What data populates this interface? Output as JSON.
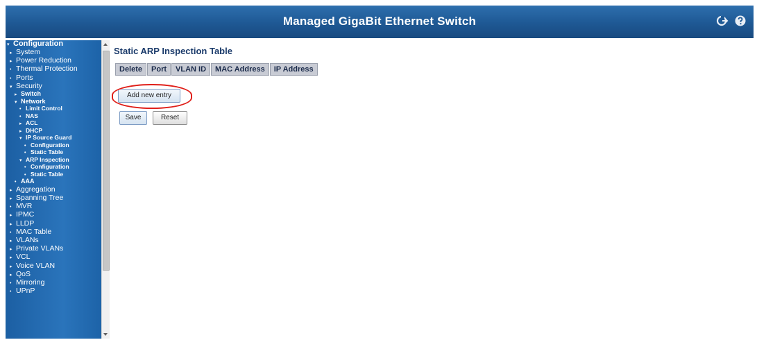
{
  "header": {
    "title": "Managed GigaBit Ethernet Switch"
  },
  "sidebar": {
    "items": [
      {
        "label": "Configuration",
        "marker": "▾",
        "level": 0
      },
      {
        "label": "System",
        "marker": "▸",
        "level": 1
      },
      {
        "label": "Power Reduction",
        "marker": "▸",
        "level": 1
      },
      {
        "label": "Thermal Protection",
        "marker": "•",
        "level": 1
      },
      {
        "label": "Ports",
        "marker": "•",
        "level": 1
      },
      {
        "label": "Security",
        "marker": "▾",
        "level": 1
      },
      {
        "label": "Switch",
        "marker": "▸",
        "level": 2
      },
      {
        "label": "Network",
        "marker": "▾",
        "level": 2
      },
      {
        "label": "Limit Control",
        "marker": "•",
        "level": 3
      },
      {
        "label": "NAS",
        "marker": "•",
        "level": 3
      },
      {
        "label": "ACL",
        "marker": "▸",
        "level": 3
      },
      {
        "label": "DHCP",
        "marker": "▸",
        "level": 3
      },
      {
        "label": "IP Source Guard",
        "marker": "▾",
        "level": 3
      },
      {
        "label": "Configuration",
        "marker": "•",
        "level": 4
      },
      {
        "label": "Static Table",
        "marker": "•",
        "level": 4
      },
      {
        "label": "ARP Inspection",
        "marker": "▾",
        "level": 3
      },
      {
        "label": "Configuration",
        "marker": "•",
        "level": 4
      },
      {
        "label": "Static Table",
        "marker": "•",
        "level": 4
      },
      {
        "label": "AAA",
        "marker": "•",
        "level": 2
      },
      {
        "label": "Aggregation",
        "marker": "▸",
        "level": 1
      },
      {
        "label": "Spanning Tree",
        "marker": "▸",
        "level": 1
      },
      {
        "label": "MVR",
        "marker": "•",
        "level": 1
      },
      {
        "label": "IPMC",
        "marker": "▸",
        "level": 1
      },
      {
        "label": "LLDP",
        "marker": "▸",
        "level": 1
      },
      {
        "label": "MAC Table",
        "marker": "•",
        "level": 1
      },
      {
        "label": "VLANs",
        "marker": "▸",
        "level": 1
      },
      {
        "label": "Private VLANs",
        "marker": "▸",
        "level": 1
      },
      {
        "label": "VCL",
        "marker": "▸",
        "level": 1
      },
      {
        "label": "Voice VLAN",
        "marker": "▸",
        "level": 1
      },
      {
        "label": "QoS",
        "marker": "▸",
        "level": 1
      },
      {
        "label": "Mirroring",
        "marker": "•",
        "level": 1
      },
      {
        "label": "UPnP",
        "marker": "•",
        "level": 1
      }
    ]
  },
  "main": {
    "title": "Static ARP Inspection Table",
    "table": {
      "columns": [
        "Delete",
        "Port",
        "VLAN ID",
        "MAC Address",
        "IP Address"
      ]
    },
    "add_button_label": "Add new entry",
    "save_label": "Save",
    "reset_label": "Reset"
  },
  "colors": {
    "header_bg": "#1f5a96",
    "sidebar_bg": "#2a74bb",
    "highlight": "#e0201a"
  },
  "icons": [
    "logout-icon",
    "help-icon"
  ]
}
